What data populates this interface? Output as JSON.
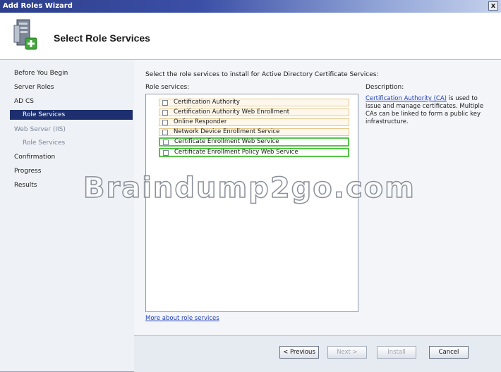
{
  "window": {
    "title": "Add Roles Wizard",
    "close_label": "x"
  },
  "header": {
    "page_title": "Select Role Services",
    "icon": "server-roles-icon"
  },
  "nav": {
    "items": [
      {
        "label": "Before You Begin",
        "state": "normal"
      },
      {
        "label": "Server Roles",
        "state": "normal"
      },
      {
        "label": "AD CS",
        "state": "normal"
      },
      {
        "label": "Role Services",
        "state": "selected"
      },
      {
        "label": "Web Server (IIS)",
        "state": "dim"
      },
      {
        "label": "Role Services",
        "state": "dim"
      },
      {
        "label": "Confirmation",
        "state": "normal"
      },
      {
        "label": "Progress",
        "state": "normal"
      },
      {
        "label": "Results",
        "state": "normal"
      }
    ]
  },
  "main": {
    "intro": "Select the role services to install for Active Directory Certificate Services:",
    "role_services_label": "Role services:",
    "description_label": "Description:",
    "role_services": [
      {
        "label": "Certification Authority",
        "checked": false,
        "highlight": "orange"
      },
      {
        "label": "Certification Authority Web Enrollment",
        "checked": false,
        "highlight": "orange"
      },
      {
        "label": "Online Responder",
        "checked": false,
        "highlight": "orange"
      },
      {
        "label": "Network Device Enrollment Service",
        "checked": false,
        "highlight": "orange"
      },
      {
        "label": "Certificate Enrollment Web Service",
        "checked": false,
        "highlight": "green"
      },
      {
        "label": "Certificate Enrollment Policy Web Service",
        "checked": false,
        "highlight": "green"
      }
    ],
    "description": {
      "link_text": "Certification Authority (CA)",
      "text": " is used to issue and manage certificates. Multiple CAs can be linked to form a public key infrastructure."
    },
    "more_link": "More about role services"
  },
  "footer": {
    "previous_label": "< Previous",
    "next_label": "Next >",
    "install_label": "Install",
    "cancel_label": "Cancel"
  },
  "watermark": "Braindump2go.com",
  "colors": {
    "selected_nav": "#1d2f6f",
    "green_highlight": "#57c44a",
    "orange_highlight": "#e6c98a",
    "link": "#1f3fb6"
  }
}
